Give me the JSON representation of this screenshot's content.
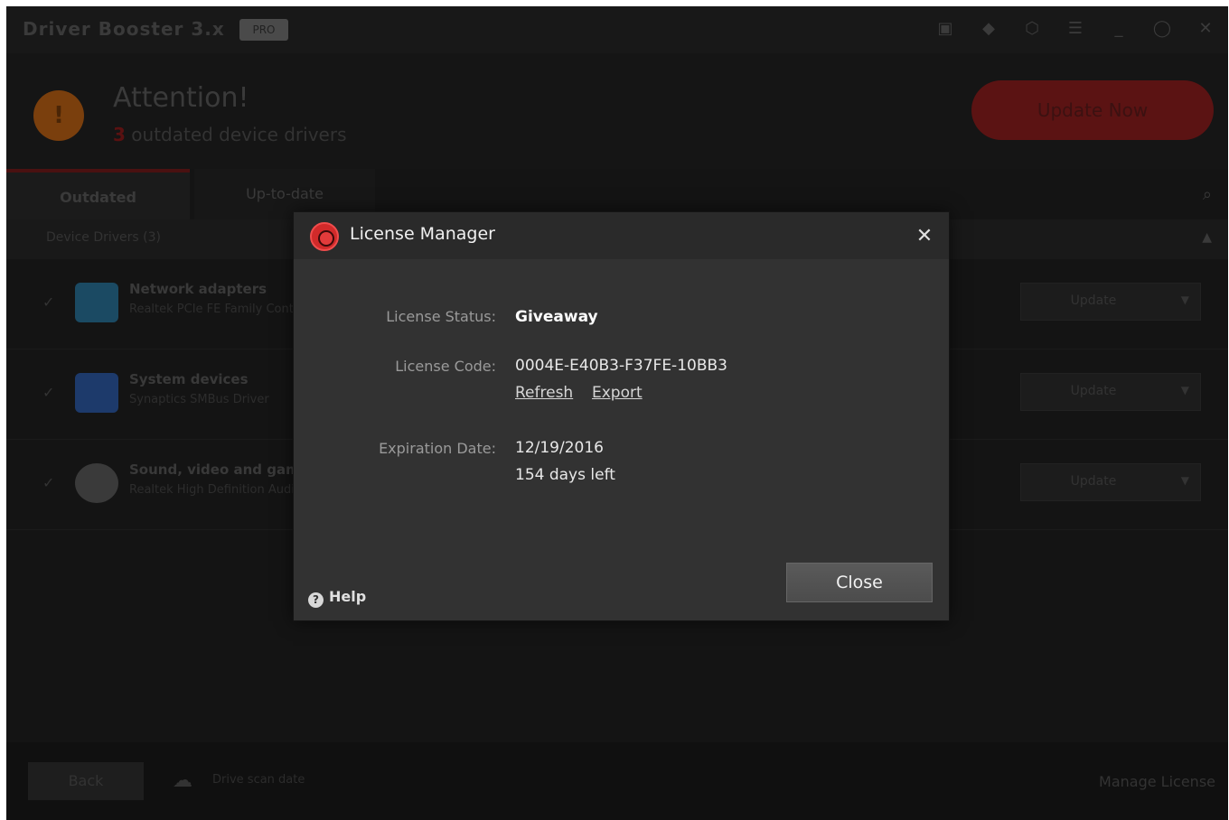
{
  "app": {
    "title": "Driver Booster 3.x",
    "badge": "PRO",
    "titlebar_icons": [
      "gift-icon",
      "shirt-icon",
      "shield-icon",
      "menu-icon",
      "minimize-icon",
      "feedback-icon",
      "close-icon"
    ],
    "attention": "Attention!",
    "outdated_count": "3",
    "outdated_text": " outdated device drivers",
    "update_now": "Update Now",
    "tabs": [
      "Outdated",
      "Up-to-date"
    ],
    "group_title": "Device Drivers (3)",
    "rows": [
      {
        "name": "Network adapters",
        "desc": "Realtek PCIe FE Family Controller",
        "button": "Update",
        "icon_color": "#1b4a63"
      },
      {
        "name": "System devices",
        "desc": "Synaptics SMBus Driver",
        "button": "Update",
        "icon_color": "#1d3a6b"
      },
      {
        "name": "Sound, video and game controllers",
        "desc": "Realtek High Definition Audio",
        "button": "Update",
        "icon_color": "#3a3a3a"
      }
    ],
    "footer": {
      "back": "Back",
      "cloud_text": "Drive scan date",
      "manage_license": "Manage License"
    }
  },
  "dialog": {
    "title": "License Manager",
    "status_label": "License Status:",
    "status_value": "Giveaway",
    "code_label": "License Code:",
    "code_value": "0004E-E40B3-F37FE-10BB3",
    "refresh_link": "Refresh",
    "export_link": "Export",
    "expiry_label": "Expiration Date:",
    "expiry_value": "12/19/2016",
    "days_left": "154 days left",
    "help": "Help",
    "close_button": "Close",
    "accent_color": "#d12a2a"
  }
}
